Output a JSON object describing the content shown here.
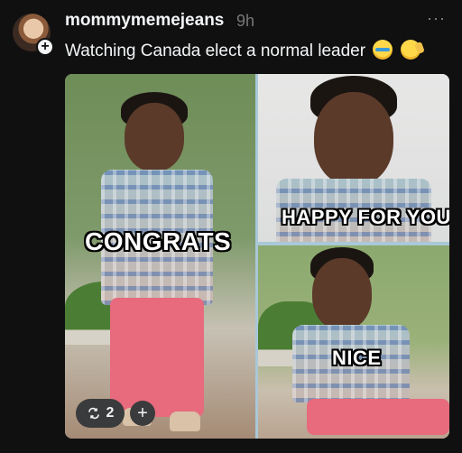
{
  "post": {
    "username": "mommymemejeans",
    "time": "9h",
    "more": "···",
    "caption": "Watching Canada elect a normal leader",
    "avatar_plus": "+",
    "emojis": [
      "loudly-crying-face",
      "saluting-face"
    ]
  },
  "meme": {
    "left_text": "CONGRATS",
    "top_right_text": "HAPPY FOR YOU",
    "bottom_right_text": "NICE"
  },
  "actions": {
    "repost_icon": "repost-icon",
    "repost_count": "2",
    "add_icon": "+"
  }
}
